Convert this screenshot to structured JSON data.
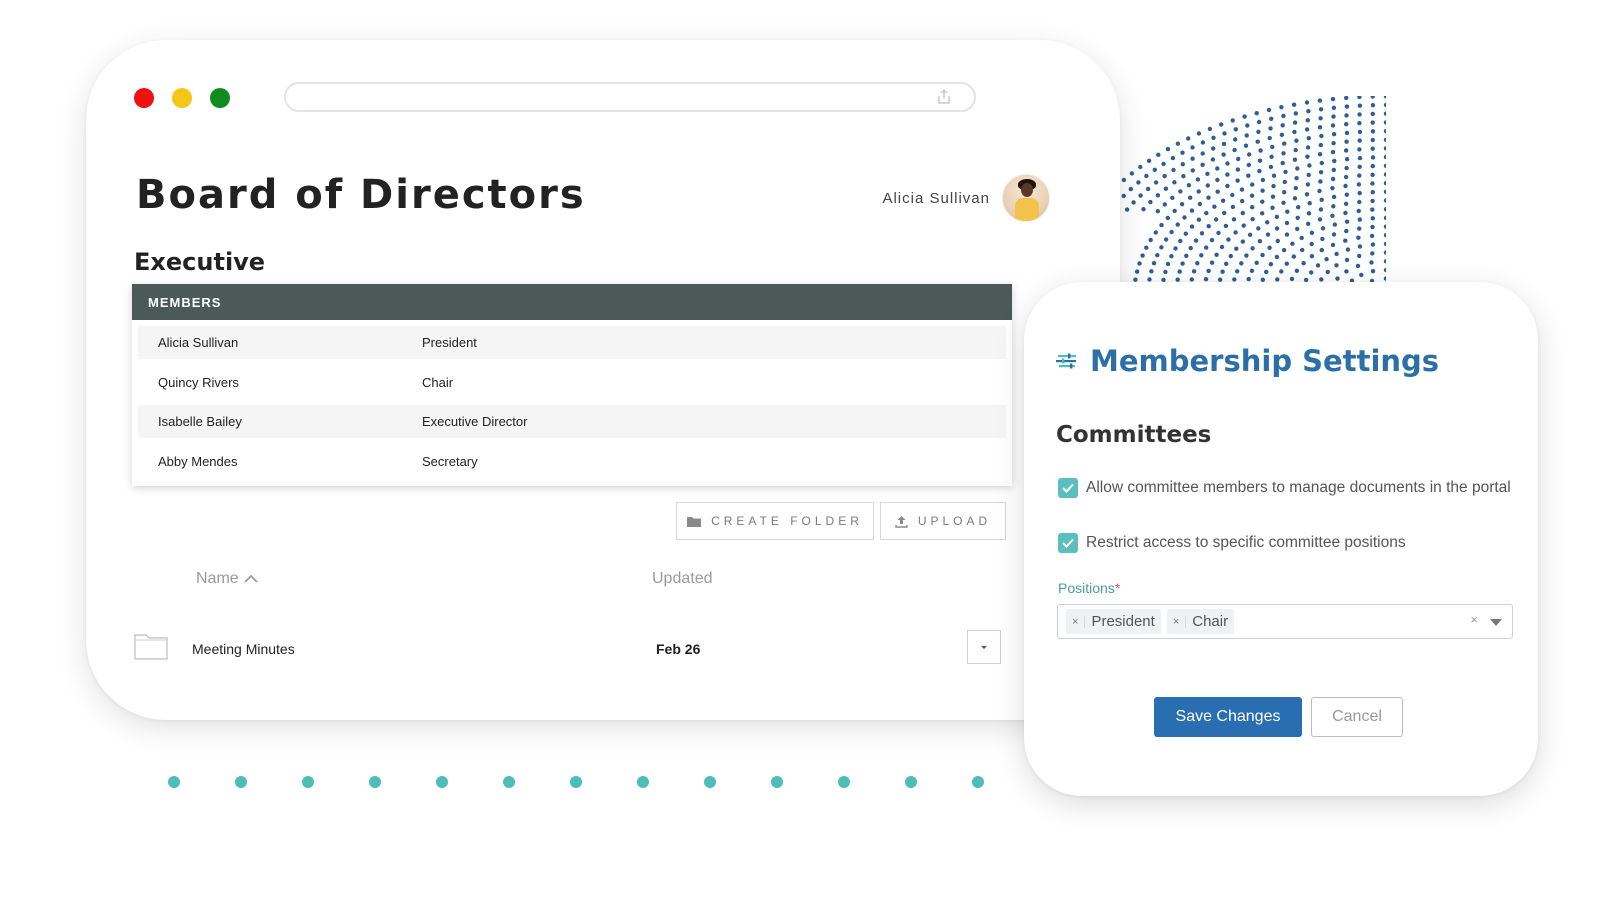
{
  "colors": {
    "traffic_red": "#ef1010",
    "traffic_yellow": "#f5c518",
    "traffic_green": "#118a1e",
    "members_header_bg": "#4b5a58",
    "accent_blue": "#2c6fa8",
    "teal": "#5bbfbf",
    "dot_blue": "#2c5f99",
    "dot_teal": "#4dbdb7"
  },
  "window": {
    "page_title": "Board of Directors",
    "user_name": "Alicia Sullivan"
  },
  "executive": {
    "section_title": "Executive",
    "members_header": "MEMBERS",
    "members": [
      {
        "name": "Alicia Sullivan",
        "role": "President"
      },
      {
        "name": "Quincy Rivers",
        "role": "Chair"
      },
      {
        "name": "Isabelle Bailey",
        "role": "Executive Director"
      },
      {
        "name": "Abby Mendes",
        "role": "Secretary"
      }
    ]
  },
  "files": {
    "create_folder_label": "CREATE FOLDER",
    "upload_label": "UPLOAD",
    "col_name": "Name",
    "col_updated": "Updated",
    "sort_indicator": "ascending",
    "items": [
      {
        "name": "Meeting Minutes",
        "updated": "Feb 26",
        "icon": "folder-icon"
      }
    ]
  },
  "settings": {
    "title": "Membership Settings",
    "section": "Committees",
    "options": [
      {
        "label": "Allow committee members to manage documents in the portal",
        "checked": true
      },
      {
        "label": "Restrict access to specific committee positions",
        "checked": true
      }
    ],
    "positions_label": "Positions",
    "required_marker": "*",
    "selected_positions": [
      "President",
      "Chair"
    ],
    "remove_glyph": "×",
    "clear_glyph": "×",
    "save_label": "Save Changes",
    "cancel_label": "Cancel"
  }
}
